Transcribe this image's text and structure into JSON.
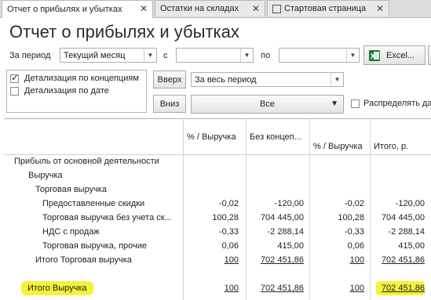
{
  "tabs": [
    {
      "label": "Отчет о прибылях и убытках",
      "close": "✕"
    },
    {
      "label": "Остатки на складах",
      "close": "✕"
    },
    {
      "label": "Стартовая страница",
      "close": "✕"
    }
  ],
  "page": {
    "title": "Отчет о прибылях и убытках"
  },
  "filters": {
    "period_label": "За период",
    "period_value": "Текущий месяц",
    "from_label": "с",
    "from_value": "",
    "to_label": "по",
    "to_value": "",
    "excel_label": "Excel..."
  },
  "options": {
    "by_concepts": {
      "label": "Детализация по концепциям",
      "checked": true
    },
    "by_date": {
      "label": "Детализация по дате",
      "checked": false
    },
    "up_button": "Вверх",
    "down_button": "Вниз",
    "range_value": "За весь период",
    "group_value": "Все",
    "distribute_label": "Распределять да",
    "distribute_checked": false
  },
  "table": {
    "headers": [
      "% / Выручка",
      "Без концеп...",
      "% / Выручка",
      "Итого, р."
    ],
    "rows": [
      {
        "label": "Прибыль от основной деятельности",
        "c1": "",
        "c2": "",
        "c3": "",
        "c4": ""
      },
      {
        "label": "Выручка",
        "c1": "",
        "c2": "",
        "c3": "",
        "c4": ""
      },
      {
        "label": "Торговая выручка",
        "c1": "",
        "c2": "",
        "c3": "",
        "c4": ""
      },
      {
        "label": "Предоставленные скидки",
        "c1": "-0,02",
        "c2": "-120,00",
        "c3": "-0,02",
        "c4": "-120,00"
      },
      {
        "label": "Торговая выручка без учета ск...",
        "c1": "100,28",
        "c2": "704 445,00",
        "c3": "100,28",
        "c4": "704 445,00"
      },
      {
        "label": "НДС с продаж",
        "c1": "-0,33",
        "c2": "-2 288,14",
        "c3": "-0,33",
        "c4": "-2 288,14"
      },
      {
        "label": "Торговая выручка, прочие",
        "c1": "0,06",
        "c2": "415,00",
        "c3": "0,06",
        "c4": "415,00"
      },
      {
        "label": "Итого Торговая выручка",
        "c1": "100",
        "c2": "702 451,86",
        "c3": "100",
        "c4": "702 451,86"
      },
      {
        "label": "",
        "c1": "",
        "c2": "",
        "c3": "",
        "c4": ""
      },
      {
        "label": "Итого Выручка",
        "c1": "100",
        "c2": "702 451,86",
        "c3": "100",
        "c4": "702 451,86"
      }
    ]
  },
  "colors": {
    "highlight": "#f6f13a",
    "excel_green": "#1e7b34"
  }
}
